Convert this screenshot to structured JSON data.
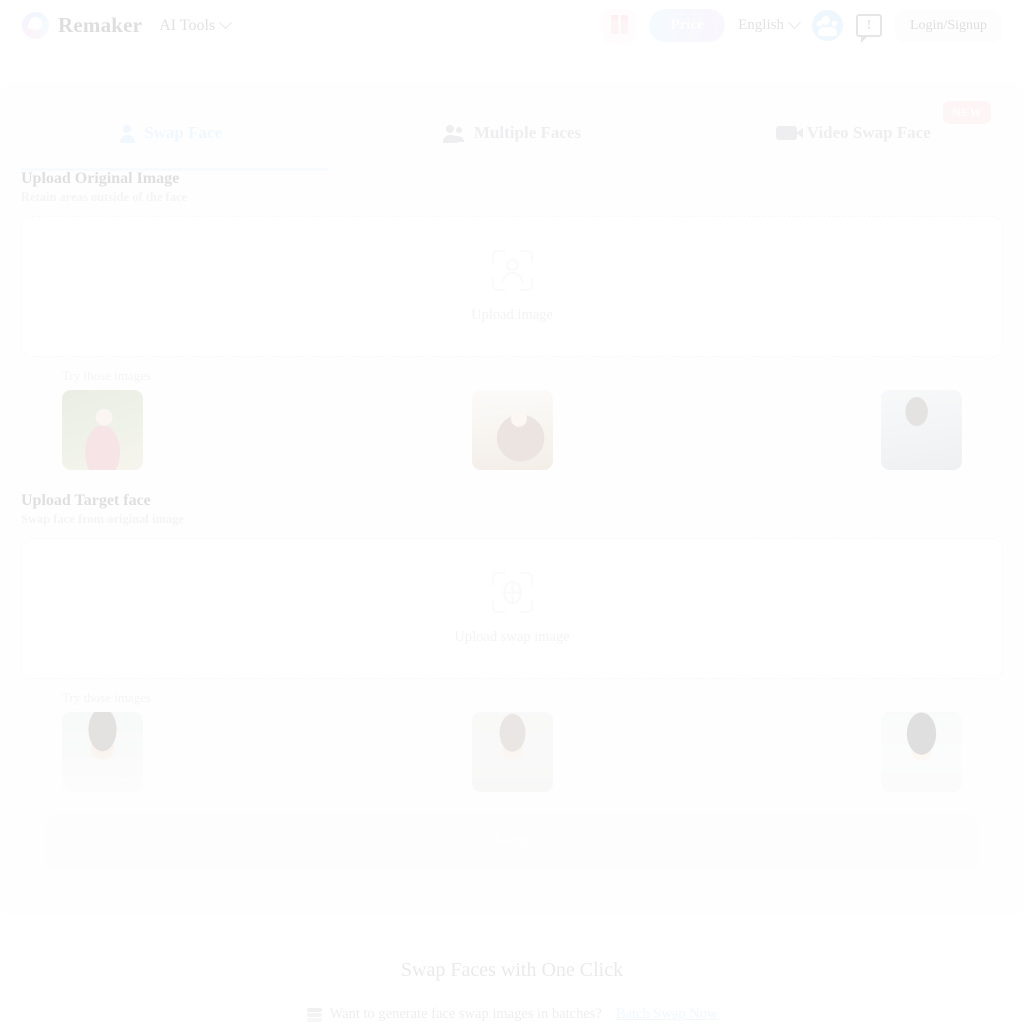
{
  "header": {
    "brand_name": "Remaker",
    "nav_label": "AI Tools",
    "gift_icon": "gift-icon",
    "price_label": "Price",
    "language_label": "English",
    "community_icon": "users-icon",
    "feedback_icon": "feedback-icon",
    "feedback_glyph": "!",
    "login_label": "Login/Signup"
  },
  "tabs": [
    {
      "label": "Swap Face",
      "icon": "person-icon",
      "active": true,
      "badge": ""
    },
    {
      "label": "Multiple Faces",
      "icon": "people-icon",
      "active": false,
      "badge": ""
    },
    {
      "label": "Video Swap Face",
      "icon": "video-icon",
      "active": false,
      "badge": "NEW"
    }
  ],
  "original_section": {
    "title": "Upload Original Image",
    "subtitle": "Retain areas outside of the face",
    "dropzone_label": "Upload image",
    "dropzone_icon": "face-scan-icon",
    "try_label": "Try those images",
    "thumbnails": [
      {
        "name": "thumb-woman-red-top",
        "style": "ph-woman-red"
      },
      {
        "name": "thumb-woman-beach",
        "style": "ph-woman-beach"
      },
      {
        "name": "thumb-cowboy-man",
        "style": "ph-cowboy"
      }
    ]
  },
  "target_section": {
    "title": "Upload Target face",
    "subtitle": "Swap face from original image",
    "dropzone_label": "Upload swap image",
    "dropzone_icon": "face-grid-icon",
    "try_label": "Try those images",
    "thumbnails": [
      {
        "name": "thumb-curly-haired-man",
        "style": "ph-man-curly"
      },
      {
        "name": "thumb-woman-portrait",
        "style": "ph-woman-plain"
      },
      {
        "name": "thumb-asian-woman",
        "style": "ph-woman-asian"
      }
    ]
  },
  "swap_button": {
    "label": "Swap",
    "disabled": true
  },
  "footer": {
    "heading": "Swap Faces with One Click",
    "batch_icon": "layers-icon",
    "batch_question": "Want to generate face swap images in batches?",
    "batch_link": "Batch Swap Now"
  },
  "colors": {
    "accent_blue": "#9ccdf3",
    "badge_pink": "#fbbcc2",
    "link_blue": "#9fcef5",
    "muted_text": "#b2b2bb"
  }
}
